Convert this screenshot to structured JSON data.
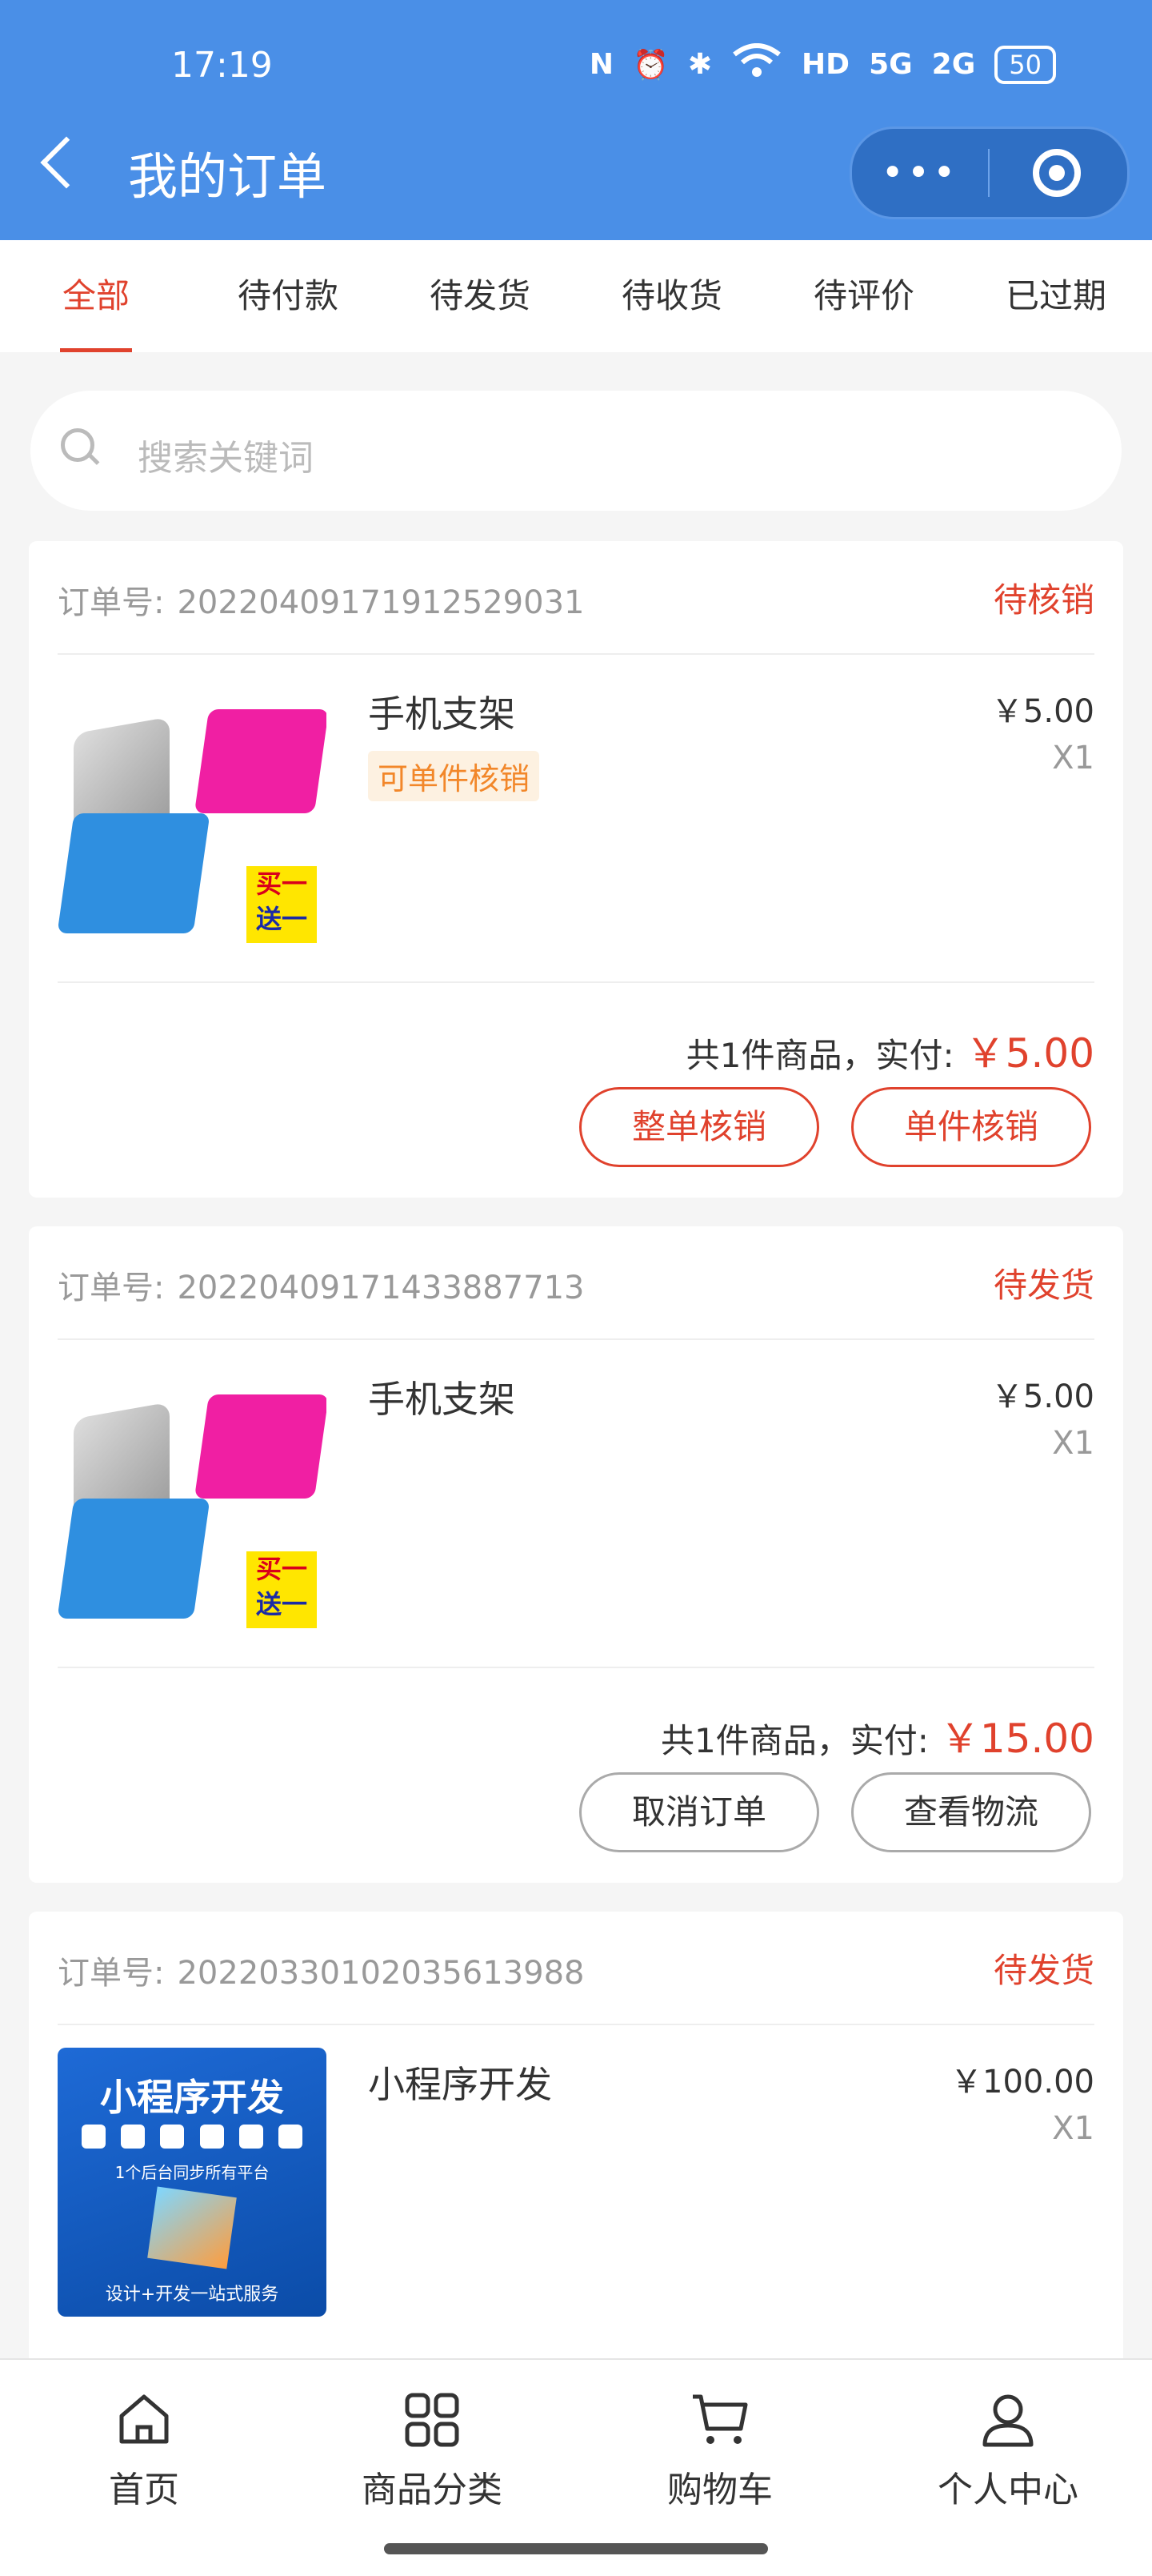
{
  "status_bar": {
    "time": "17:19",
    "icons": [
      "N",
      "⏰",
      "✱",
      "WiFi",
      "HD",
      "5G",
      "2G"
    ],
    "battery": "50"
  },
  "header": {
    "title": "我的订单",
    "menu_dots": "•••"
  },
  "tabs": [
    {
      "label": "全部",
      "active": true
    },
    {
      "label": "待付款",
      "active": false
    },
    {
      "label": "待发货",
      "active": false
    },
    {
      "label": "待收货",
      "active": false
    },
    {
      "label": "待评价",
      "active": false
    },
    {
      "label": "已过期",
      "active": false
    }
  ],
  "search": {
    "placeholder": "搜索关键词"
  },
  "orders": [
    {
      "order_label": "订单号:",
      "order_no": "20220409171912529031",
      "status": "待核销",
      "product": {
        "name": "手机支架",
        "tag": "可单件核销",
        "price": "￥5.00",
        "qty": "X1",
        "image_badge_top": "买一",
        "image_badge_bottom": "送一"
      },
      "total_text": "共1件商品，实付:",
      "total_amount": "￥5.00",
      "buttons": [
        {
          "label": "整单核销",
          "style": "red"
        },
        {
          "label": "单件核销",
          "style": "red"
        }
      ]
    },
    {
      "order_label": "订单号:",
      "order_no": "20220409171433887713",
      "status": "待发货",
      "product": {
        "name": "手机支架",
        "tag": "",
        "price": "￥5.00",
        "qty": "X1",
        "image_badge_top": "买一",
        "image_badge_bottom": "送一"
      },
      "total_text": "共1件商品，实付:",
      "total_amount": "￥15.00",
      "buttons": [
        {
          "label": "取消订单",
          "style": "gray"
        },
        {
          "label": "查看物流",
          "style": "gray"
        }
      ]
    },
    {
      "order_label": "订单号:",
      "order_no": "20220330102035613988",
      "status": "待发货",
      "product": {
        "name": "小程序开发",
        "price": "￥100.00",
        "qty": "X1",
        "image_title": "小程序开发",
        "image_line2": "1个后台同步所有平台",
        "image_line3": "设计+开发一站式服务"
      }
    }
  ],
  "bottom_nav": [
    {
      "label": "首页",
      "icon": "home-icon"
    },
    {
      "label": "商品分类",
      "icon": "grid-icon"
    },
    {
      "label": "购物车",
      "icon": "cart-icon"
    },
    {
      "label": "个人中心",
      "icon": "user-icon"
    }
  ],
  "colors": {
    "header": "#4a8fe7",
    "accent": "#e0422d",
    "tag": "#f2872a"
  }
}
